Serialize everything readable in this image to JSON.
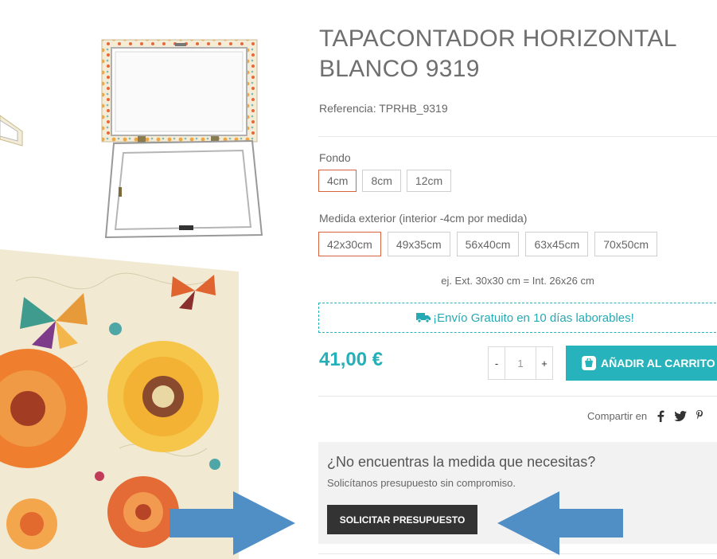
{
  "product": {
    "title_line1": "TAPACONTADOR HORIZONTAL",
    "title_line2": "BLANCO 9319",
    "reference": "Referencia: TPRHB_9319"
  },
  "depth": {
    "label": "Fondo",
    "options": [
      "4cm",
      "8cm",
      "12cm"
    ],
    "selected": "4cm"
  },
  "size": {
    "label": "Medida exterior (interior -4cm por medida)",
    "options": [
      "42x30cm",
      "49x35cm",
      "56x40cm",
      "63x45cm",
      "70x50cm"
    ],
    "selected": "42x30cm",
    "example": "ej. Ext. 30x30 cm = Int. 26x26 cm"
  },
  "shipping": {
    "text": "¡Envío Gratuito en 10 días laborables!"
  },
  "price": "41,00 €",
  "quantity": {
    "minus": "-",
    "value": "1",
    "plus": "+"
  },
  "cart_button": "AÑADIR AL CARRITO",
  "share": {
    "label": "Compartir en",
    "icons": [
      "facebook-icon",
      "twitter-icon",
      "pinterest-icon"
    ]
  },
  "quote": {
    "title": "¿No encuentras la medida que necesitas?",
    "subtitle": "Solicítanos presupuesto sin compromiso.",
    "button": "SOLICITAR PRESUPUESTO"
  },
  "colors": {
    "accent": "#26b3bb",
    "selected_border": "#d9633f",
    "dark_button": "#333333",
    "arrow": "#4f8fc6"
  }
}
